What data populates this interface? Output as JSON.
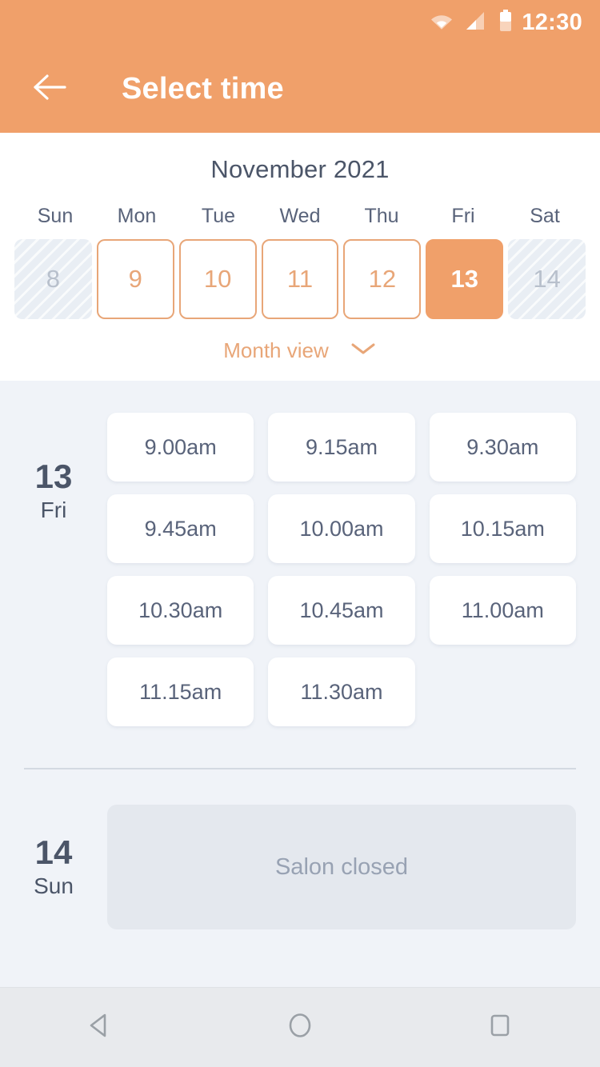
{
  "statusbar": {
    "time": "12:30",
    "icons": [
      "wifi-icon",
      "cellular-signal-icon",
      "battery-icon"
    ]
  },
  "appbar": {
    "back_icon": "arrow-left-icon",
    "title": "Select time"
  },
  "calendar": {
    "month_title": "November 2021",
    "weekdays": [
      "Sun",
      "Mon",
      "Tue",
      "Wed",
      "Thu",
      "Fri",
      "Sat"
    ],
    "days": [
      {
        "num": "8",
        "state": "disabled"
      },
      {
        "num": "9",
        "state": "available"
      },
      {
        "num": "10",
        "state": "available"
      },
      {
        "num": "11",
        "state": "available"
      },
      {
        "num": "12",
        "state": "available"
      },
      {
        "num": "13",
        "state": "selected"
      },
      {
        "num": "14",
        "state": "disabled"
      }
    ],
    "month_view_label": "Month view",
    "month_view_icon": "chevron-down-icon"
  },
  "schedule": [
    {
      "day_num": "13",
      "day_of_week": "Fri",
      "slots": [
        "9.00am",
        "9.15am",
        "9.30am",
        "9.45am",
        "10.00am",
        "10.15am",
        "10.30am",
        "10.45am",
        "11.00am",
        "11.15am",
        "11.30am"
      ]
    },
    {
      "day_num": "14",
      "day_of_week": "Sun",
      "closed_label": "Salon closed"
    }
  ],
  "navbar": {
    "back_icon": "nav-back-triangle-icon",
    "home_icon": "nav-home-circle-icon",
    "recents_icon": "nav-recents-square-icon"
  },
  "colors": {
    "accent": "#f0a06a",
    "accent_outline": "#e8a678",
    "page_bg": "#f0f3f8",
    "text_dark": "#4b5568",
    "text_muted": "#98a2b3",
    "closed_bg": "#e4e8ee"
  }
}
